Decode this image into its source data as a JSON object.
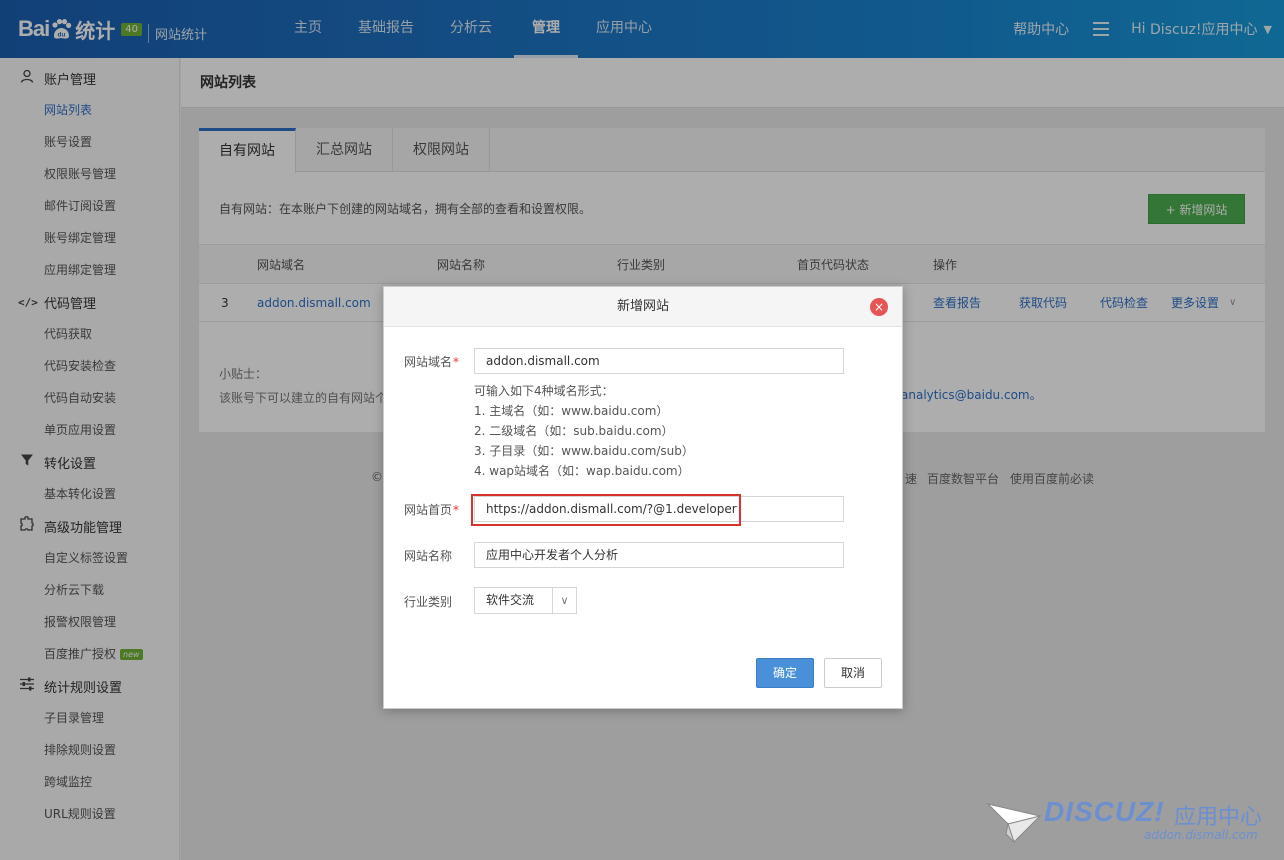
{
  "header": {
    "logo_bai": "Bai",
    "logo_du": "du",
    "logo_tongji": "统计",
    "version": "40",
    "product": "网站统计",
    "nav": [
      "主页",
      "基础报告",
      "分析云",
      "管理",
      "应用中心"
    ],
    "active_nav": "管理",
    "help": "帮助中心",
    "greeting": "Hi",
    "user": "Discuz!应用中心"
  },
  "sidebar": {
    "sections": [
      {
        "title": "账户管理",
        "icon": "user-icon",
        "items": [
          "网站列表",
          "账号设置",
          "权限账号管理",
          "邮件订阅设置",
          "账号绑定管理",
          "应用绑定管理"
        ]
      },
      {
        "title": "代码管理",
        "icon": "code-icon",
        "items": [
          "代码获取",
          "代码安装检查",
          "代码自动安装",
          "单页应用设置"
        ]
      },
      {
        "title": "转化设置",
        "icon": "funnel-icon",
        "items": [
          "基本转化设置"
        ]
      },
      {
        "title": "高级功能管理",
        "icon": "puzzle-icon",
        "items": [
          "自定义标签设置",
          "分析云下载",
          "报警权限管理",
          "百度推广授权"
        ]
      },
      {
        "title": "统计规则设置",
        "icon": "sliders-icon",
        "items": [
          "子目录管理",
          "排除规则设置",
          "跨域监控",
          "URL规则设置"
        ]
      }
    ],
    "active_item": "网站列表",
    "new_badge": "new"
  },
  "page": {
    "title": "网站列表",
    "tabs": [
      "自有网站",
      "汇总网站",
      "权限网站"
    ],
    "intro": "自有网站：在本账户下创建的网站域名，拥有全部的查看和设置权限。",
    "add_button": "+ 新增网站",
    "columns": [
      "网站域名",
      "网站名称",
      "行业类别",
      "首页代码状态",
      "操作"
    ],
    "row": {
      "index": "3",
      "domain": "addon.dismall.com",
      "actions": [
        "查看报告",
        "获取代码",
        "代码检查",
        "更多设置"
      ]
    },
    "tips_title": "小贴士：",
    "tips_text": "该账号下可以建立的自有网站个",
    "tips_mail": "analytics@baidu.com。",
    "footer_left": "©2",
    "footer_right": [
      "速",
      "百度数智平台",
      "使用百度前必读"
    ]
  },
  "modal": {
    "title": "新增网站",
    "domain_label": "网站域名",
    "domain_value": "addon.dismall.com",
    "hint_lines": [
      "可输入如下4种域名形式：",
      "1. 主域名（如：www.baidu.com）",
      "2. 二级域名（如：sub.baidu.com）",
      "3. 子目录（如：www.baidu.com/sub）",
      "4. wap站域名（如：wap.baidu.com）"
    ],
    "homepage_label": "网站首页",
    "homepage_value": "https://addon.dismall.com/?@1.developer",
    "name_label": "网站名称",
    "name_value": "应用中心开发者个人分析",
    "category_label": "行业类别",
    "category_value": "软件交流",
    "ok": "确定",
    "cancel": "取消"
  },
  "watermark": {
    "brand": "DISCUZ!",
    "brand_cn": "应用中心",
    "url": "addon.dismall.com"
  }
}
